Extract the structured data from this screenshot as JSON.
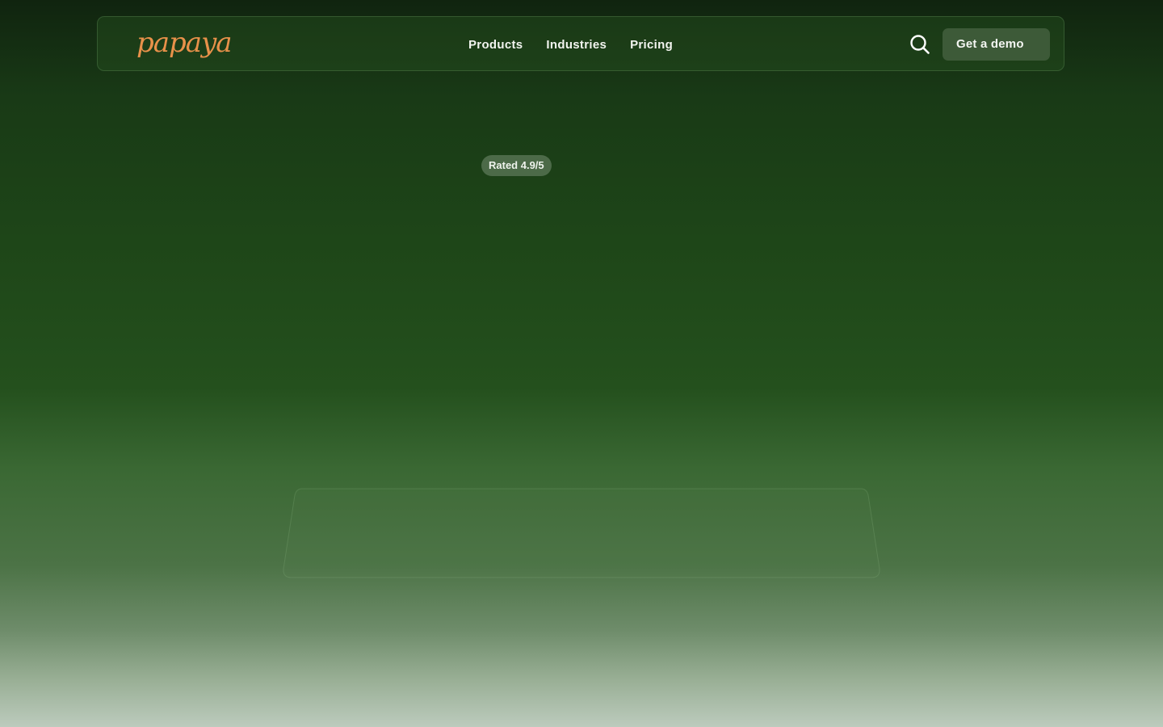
{
  "header": {
    "logo_text": "papaya",
    "nav": [
      {
        "label": "Products"
      },
      {
        "label": "Industries"
      },
      {
        "label": "Pricing"
      }
    ],
    "search_icon": "search-icon",
    "cta_label": "Get a demo"
  },
  "hero": {
    "rating_badge": "Rated 4.9/5"
  },
  "colors": {
    "brand_orange": "#e8914a",
    "nav_text": "#f2f4ef",
    "cta_bg": "#3d5a38",
    "badge_bg": "#4c6a48",
    "bg_top": "#10240f",
    "bg_mid": "#24501d",
    "bg_bottom": "#bccbbd"
  }
}
